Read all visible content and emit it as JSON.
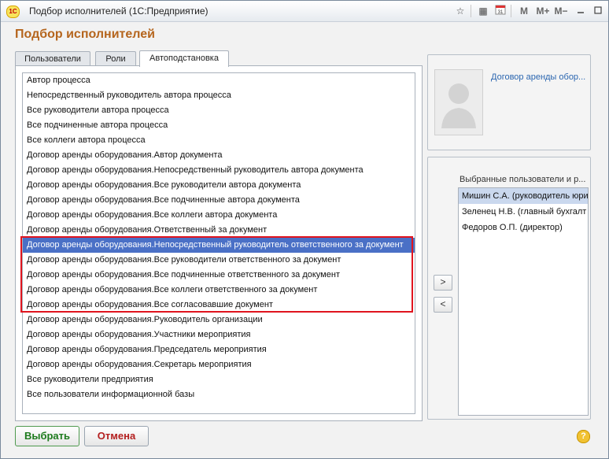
{
  "window": {
    "title": "Подбор исполнителей  (1С:Предприятие)",
    "logo_text": "1С",
    "toolbar_m": "M",
    "toolbar_mplus": "M+",
    "toolbar_mminus": "M−"
  },
  "form_title": "Подбор исполнителей",
  "tabs": [
    "Пользователи",
    "Роли",
    "Автоподстановка"
  ],
  "active_tab_index": 2,
  "left_list": {
    "items": [
      "Автор процесса",
      "Непосредственный руководитель автора процесса",
      "Все руководители автора процесса",
      "Все подчиненные автора процесса",
      "Все коллеги автора процесса",
      "Договор аренды оборудования.Автор документа",
      "Договор аренды оборудования.Непосредственный руководитель автора документа",
      "Договор аренды оборудования.Все руководители автора документа",
      "Договор аренды оборудования.Все подчиненные автора документа",
      "Договор аренды оборудования.Все коллеги автора документа",
      "Договор аренды оборудования.Ответственный за документ",
      "Договор аренды оборудования.Непосредственный руководитель ответственного за документ",
      "Договор аренды оборудования.Все руководители ответственного за документ",
      "Договор аренды оборудования.Все подчиненные ответственного за документ",
      "Договор аренды оборудования.Все коллеги ответственного за документ",
      "Договор аренды оборудования.Все согласовавшие документ",
      "Договор аренды оборудования.Руководитель организации",
      "Договор аренды оборудования.Участники мероприятия",
      "Договор аренды оборудования.Председатель мероприятия",
      "Договор аренды оборудования.Секретарь мероприятия",
      "Все руководители предприятия",
      "Все пользователи информационной базы"
    ],
    "selected_index": 11
  },
  "document_link": "Договор аренды обор...",
  "selected_users": {
    "label": "Выбранные пользователи и р...",
    "items": [
      "Мишин С.А. (руководитель юри",
      "Зеленец Н.В. (главный бухгалт",
      "Федоров О.П. (директор)"
    ],
    "selected_index": 0
  },
  "buttons": {
    "add": ">",
    "remove": "<",
    "ok": "Выбрать",
    "cancel": "Отмена",
    "help": "?"
  },
  "icons": {
    "favorite": "star-icon",
    "calculator": "calculator-icon",
    "calendar": "calendar-icon",
    "minimize": "minimize-icon",
    "maximize": "maximize-icon",
    "close": "close-icon"
  },
  "colors": {
    "selection": "#4a70c6",
    "form_title": "#b5651d",
    "link": "#2b66b0",
    "highlight": "#e0141e",
    "ok_button": "#1c7a1c",
    "cancel_button": "#b42020"
  }
}
